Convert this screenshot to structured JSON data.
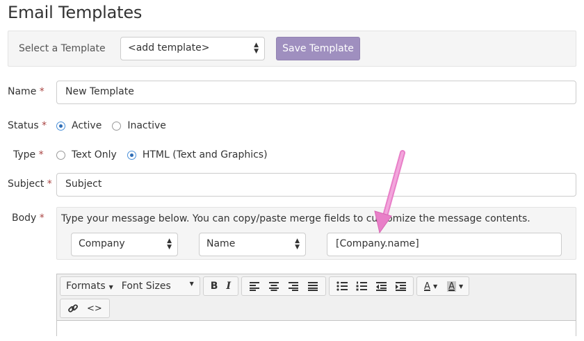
{
  "page": {
    "title": "Email Templates"
  },
  "template_selector": {
    "label": "Select a Template",
    "selected": "<add template>",
    "save_label": "Save Template"
  },
  "colors": {
    "accent_button": "#9f8fbf",
    "required": "#a94442",
    "arrow": "#e87fc8"
  },
  "form": {
    "required_marker": "*",
    "name": {
      "label": "Name",
      "value": "New Template"
    },
    "status": {
      "label": "Status",
      "options": [
        "Active",
        "Inactive"
      ],
      "selected": "Active"
    },
    "type": {
      "label": "Type",
      "options": [
        "Text Only",
        "HTML (Text and Graphics)"
      ],
      "selected": "HTML (Text and Graphics)"
    },
    "subject": {
      "label": "Subject",
      "value": "Subject"
    },
    "body": {
      "label": "Body",
      "hint": "Type your message below. You can copy/paste merge fields to customize the message contents.",
      "merge_object": "Company",
      "merge_field": "Name",
      "merge_result": "[Company.name]"
    }
  },
  "editor_toolbar": {
    "formats_label": "Formats",
    "font_sizes_label": "Font Sizes",
    "bold": "B",
    "italic": "I",
    "text_color_glyph": "A",
    "bg_color_glyph": "A",
    "icons": [
      "align-left-icon",
      "align-center-icon",
      "align-right-icon",
      "align-justify-icon",
      "bullet-list-icon",
      "numbered-list-icon",
      "outdent-icon",
      "indent-icon",
      "link-icon",
      "code-icon"
    ]
  }
}
